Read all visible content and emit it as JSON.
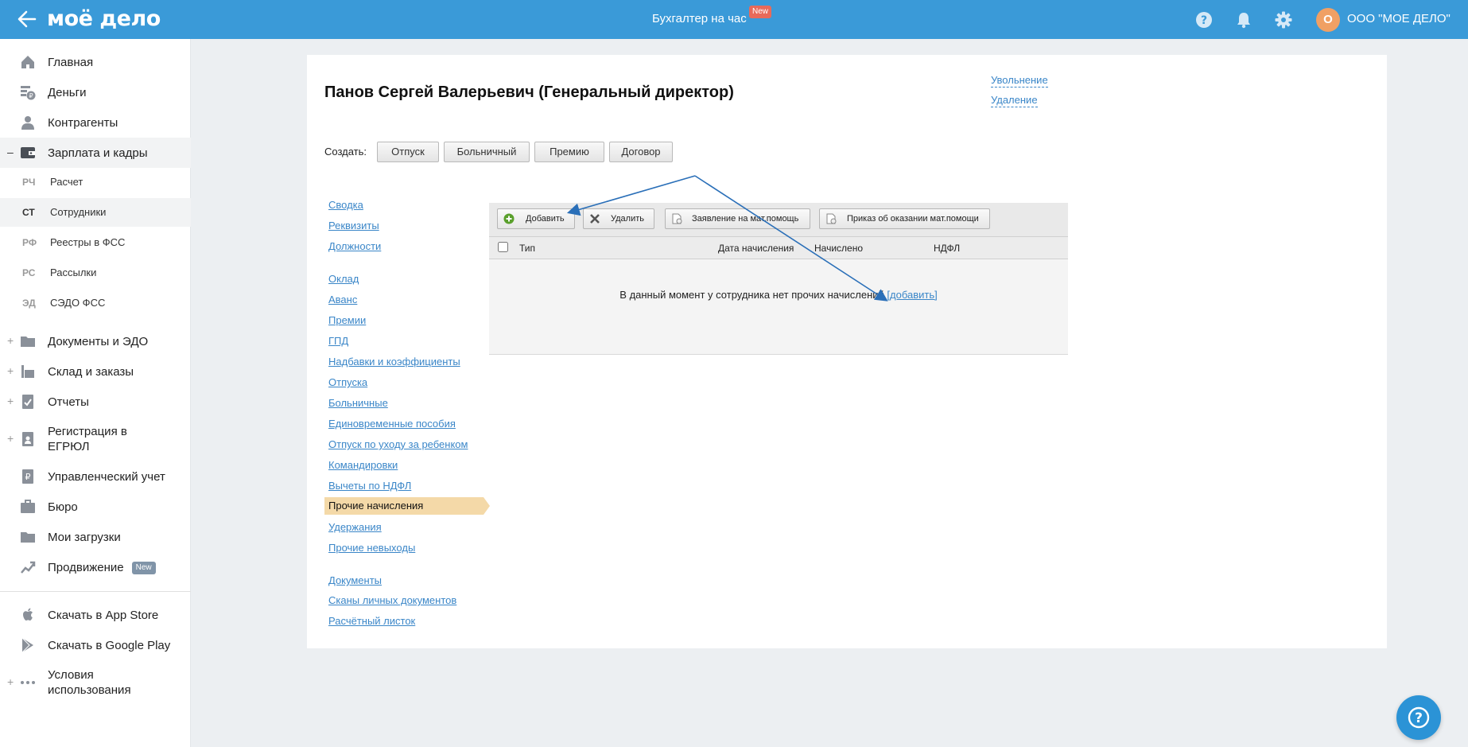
{
  "header": {
    "logo": "моё дело",
    "center_link": "Бухгалтер на час",
    "center_badge": "New",
    "org_initial": "О",
    "org_name": "ООО \"МОЕ ДЕЛО\"",
    "brand_color": "#3a9ad8"
  },
  "sidebar": {
    "items": [
      {
        "label": "Главная",
        "icon": "home-icon"
      },
      {
        "label": "Деньги",
        "icon": "money-icon"
      },
      {
        "label": "Контрагенты",
        "icon": "contractors-icon"
      },
      {
        "label": "Зарплата и кадры",
        "icon": "wallet-icon",
        "toggle": "–"
      },
      {
        "label": "Документы и ЭДО",
        "icon": "folder-icon",
        "toggle": "+"
      },
      {
        "label": "Склад и заказы",
        "icon": "warehouse-icon",
        "toggle": "+"
      },
      {
        "label": "Отчеты",
        "icon": "reports-icon",
        "toggle": "+"
      },
      {
        "label": "Регистрация в",
        "label2": "ЕГРЮЛ",
        "icon": "registration-icon",
        "toggle": "+"
      },
      {
        "label": "Управленческий учет",
        "icon": "management-icon"
      },
      {
        "label": "Бюро",
        "icon": "briefcase-icon"
      },
      {
        "label": "Мои загрузки",
        "icon": "downloads-icon"
      },
      {
        "label": "Продвижение",
        "icon": "promotion-icon",
        "badge": "New"
      },
      {
        "label": "Скачать в App Store",
        "icon": "apple-icon"
      },
      {
        "label": "Скачать в Google Play",
        "icon": "google-play-icon"
      },
      {
        "label": "Условия",
        "label2": "использования",
        "icon": "more-dots-icon",
        "toggle": "+"
      }
    ],
    "subitems": [
      {
        "abbr": "РЧ",
        "label": "Расчет"
      },
      {
        "abbr": "СТ",
        "label": "Сотрудники"
      },
      {
        "abbr": "РФ",
        "label": "Реестры в ФСС"
      },
      {
        "abbr": "РС",
        "label": "Рассылки"
      },
      {
        "abbr": "ЭД",
        "label": "СЭДО ФСС"
      }
    ]
  },
  "employee": {
    "title": "Панов Сергей Валерьевич (Генеральный директор)",
    "dismiss_link": "Увольнение",
    "delete_link": "Удаление"
  },
  "create": {
    "label": "Создать:",
    "buttons": [
      "Отпуск",
      "Больничный",
      "Премию",
      "Договор"
    ]
  },
  "left_nav": {
    "group1": [
      "Сводка",
      "Реквизиты",
      "Должности"
    ],
    "group2": [
      "Оклад",
      "Аванс",
      "Премии",
      "ГПД",
      "Надбавки и коэффициенты",
      "Отпуска",
      "Больничные",
      "Единовременные пособия",
      "Отпуск по уходу за ребенком",
      "Командировки",
      "Вычеты по НДФЛ",
      "Прочие начисления",
      "Удержания",
      "Прочие невыходы"
    ],
    "group3": [
      "Документы",
      "Сканы личных документов",
      "Расчётный листок"
    ]
  },
  "grid": {
    "toolbar": {
      "add": "Добавить",
      "delete": "Удалить",
      "application": "Заявление на мат.помощь",
      "order": "Приказ об оказании мат.помощи"
    },
    "columns": [
      "Тип",
      "Дата начисления",
      "Начислено",
      "НДФЛ"
    ],
    "empty_text": "В данный момент у сотрудника нет прочих начислений",
    "empty_link": "[добавить]"
  }
}
